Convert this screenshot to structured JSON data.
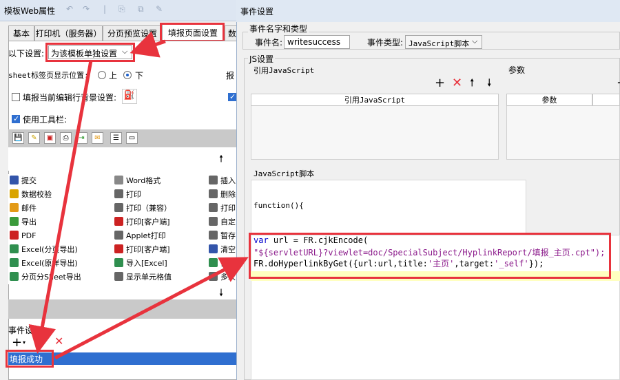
{
  "left_window": {
    "title": "模板Web属性",
    "tabs": [
      "基本",
      "打印机（服务器）",
      "分页预览设置",
      "填报页面设置",
      "数"
    ],
    "selected_tab": "填报页面设置",
    "setting_label": "以下设置:",
    "setting_value": "为该模板单独设置",
    "sheet_tab_label": "sheet标签页显示位置:",
    "sheet_tab_options": [
      "上",
      "下"
    ],
    "sheet_tab_selected": "下",
    "right_cut_label": "报",
    "fill_bg_label": "填报当前编辑行背景设置:",
    "use_toolbar_label": "使用工具栏:",
    "list_col1": [
      "提交",
      "数据校验",
      "邮件",
      "导出",
      "PDF",
      "Excel(分页导出)",
      "Excel(原样导出)",
      "分页分Sheet导出"
    ],
    "list_col2": [
      "Word格式",
      "打印",
      "打印（兼容）",
      "打印[客户端]",
      "Applet打印",
      "打印[客户端]",
      "导入[Excel]",
      "显示单元格值"
    ],
    "list_col3": [
      "插入",
      "删除",
      "打印",
      "自定",
      "暂存",
      "清空",
      "自",
      "多次"
    ],
    "event_label": "事件设置",
    "event_item": "填报成功"
  },
  "right_window": {
    "title": "事件设置",
    "event_group": "事件名字和类型",
    "event_name_label": "事件名:",
    "event_name_value": "writesuccess",
    "event_type_label": "事件类型:",
    "event_type_value": "JavaScript脚本",
    "js_group": "JS设置",
    "ref_js_label": "引用JavaScript",
    "params_label": "参数",
    "ref_js_header": "引用JavaScript",
    "params_header": "参数",
    "script_label": "JavaScript脚本",
    "function_sig": "function(){",
    "code": {
      "kw_var": "var",
      "line1_rest": " url = FR.cjkEncode(",
      "line2": "\"${servletURL}?viewlet=doc/SpecialSubject/HyplinkReport/填报_主页.cpt\");",
      "line3_a": "FR.doHyperlinkByGet({url:url,title:",
      "line3_s1": "'主页'",
      "line3_b": ",target:",
      "line3_s2": "'_self'",
      "line3_c": "});"
    }
  },
  "colors": {
    "annotation_red": "#e8333d",
    "selection_blue": "#2f6fd0",
    "code_highlight": "#ffffc0"
  }
}
